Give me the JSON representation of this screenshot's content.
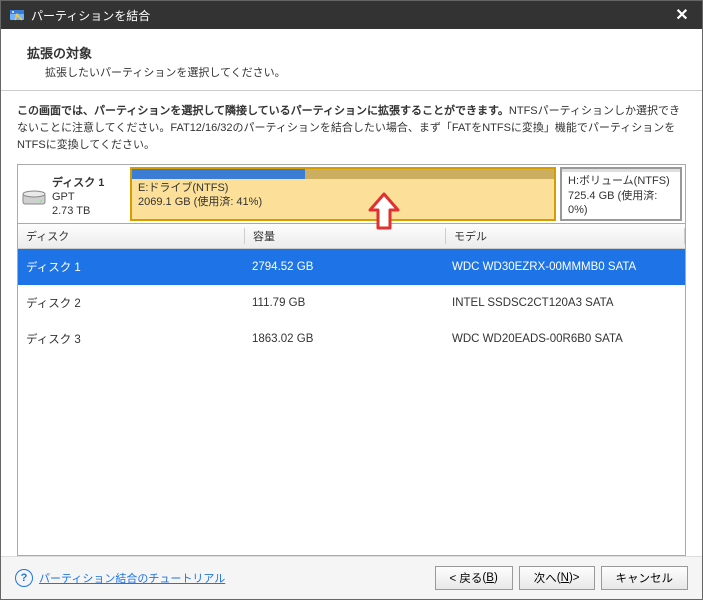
{
  "titlebar": {
    "title": "パーティションを結合"
  },
  "heading": {
    "title": "拡張の対象",
    "subtitle": "拡張したいパーティションを選択してください。"
  },
  "instructions_html": "この画面では、パーティションを選択して隣接しているパーティションに拡張することができます。",
  "instructions_rest": "NTFSパーティションしか選択できないことに注意してください。FAT12/16/32のパーティションを結合したい場合、まず「FATをNTFSに変換」機能でパーティションをNTFSに変換してください。",
  "disk_map": {
    "disk_label": "ディスク 1",
    "scheme": "GPT",
    "total": "2.73 TB",
    "partitions": [
      {
        "id": "e",
        "name": "E:ドライブ(NTFS)",
        "detail": "2069.1 GB (使用済: 41%)",
        "fill_pct": 41,
        "selected": true
      },
      {
        "id": "h",
        "name": "H:ボリューム(NTFS)",
        "detail": "725.4 GB (使用済: 0%)",
        "fill_pct": 0,
        "selected": false
      }
    ]
  },
  "table": {
    "headers": {
      "disk": "ディスク",
      "capacity": "容量",
      "model": "モデル"
    },
    "rows": [
      {
        "disk": "ディスク 1",
        "capacity": "2794.52 GB",
        "model": "WDC WD30EZRX-00MMMB0 SATA",
        "selected": true
      },
      {
        "disk": "ディスク 2",
        "capacity": "111.79 GB",
        "model": "INTEL SSDSC2CT120A3 SATA",
        "selected": false
      },
      {
        "disk": "ディスク 3",
        "capacity": "1863.02 GB",
        "model": "WDC WD20EADS-00R6B0 SATA",
        "selected": false
      }
    ]
  },
  "footer": {
    "help_text": "パーティション結合のチュートリアル",
    "back_label": "< 戻る",
    "back_accel": "B",
    "next_label": "次へ",
    "next_accel": "N",
    "next_suffix": " >",
    "cancel_label": "キャンセル"
  }
}
